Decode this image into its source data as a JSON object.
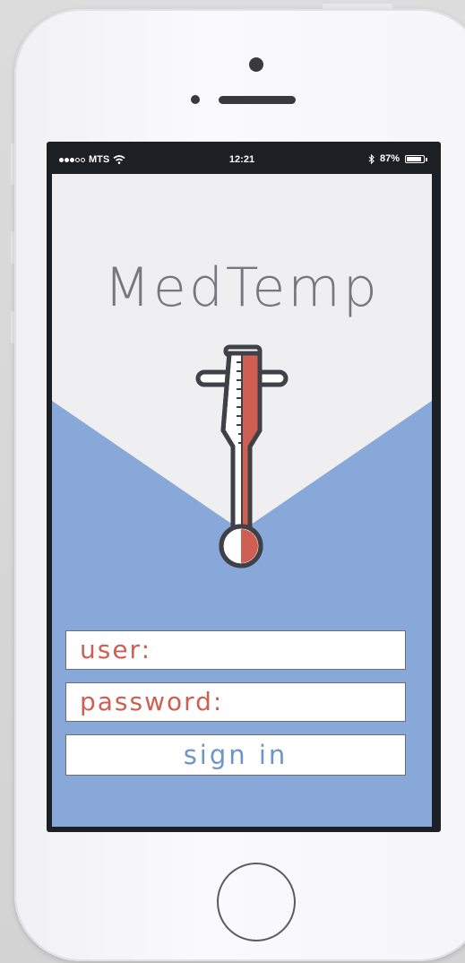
{
  "status_bar": {
    "carrier": "MTS",
    "time": "12:21",
    "battery_text": "87%",
    "battery_level": 0.87,
    "signal_bars_filled": 3,
    "signal_bars_total": 5
  },
  "app": {
    "title": "MedTemp",
    "logo_icon": "thermometer-icon"
  },
  "login": {
    "user_label": "user:",
    "password_label": "password:",
    "sign_in_label": "sign in"
  },
  "colors": {
    "accent_red": "#cf5f52",
    "accent_blue": "#87a8d8",
    "screen_background": "#efeff1",
    "title_gray": "#77777d",
    "outline_dark": "#3f4147",
    "sign_in_text": "#6e95c9"
  }
}
